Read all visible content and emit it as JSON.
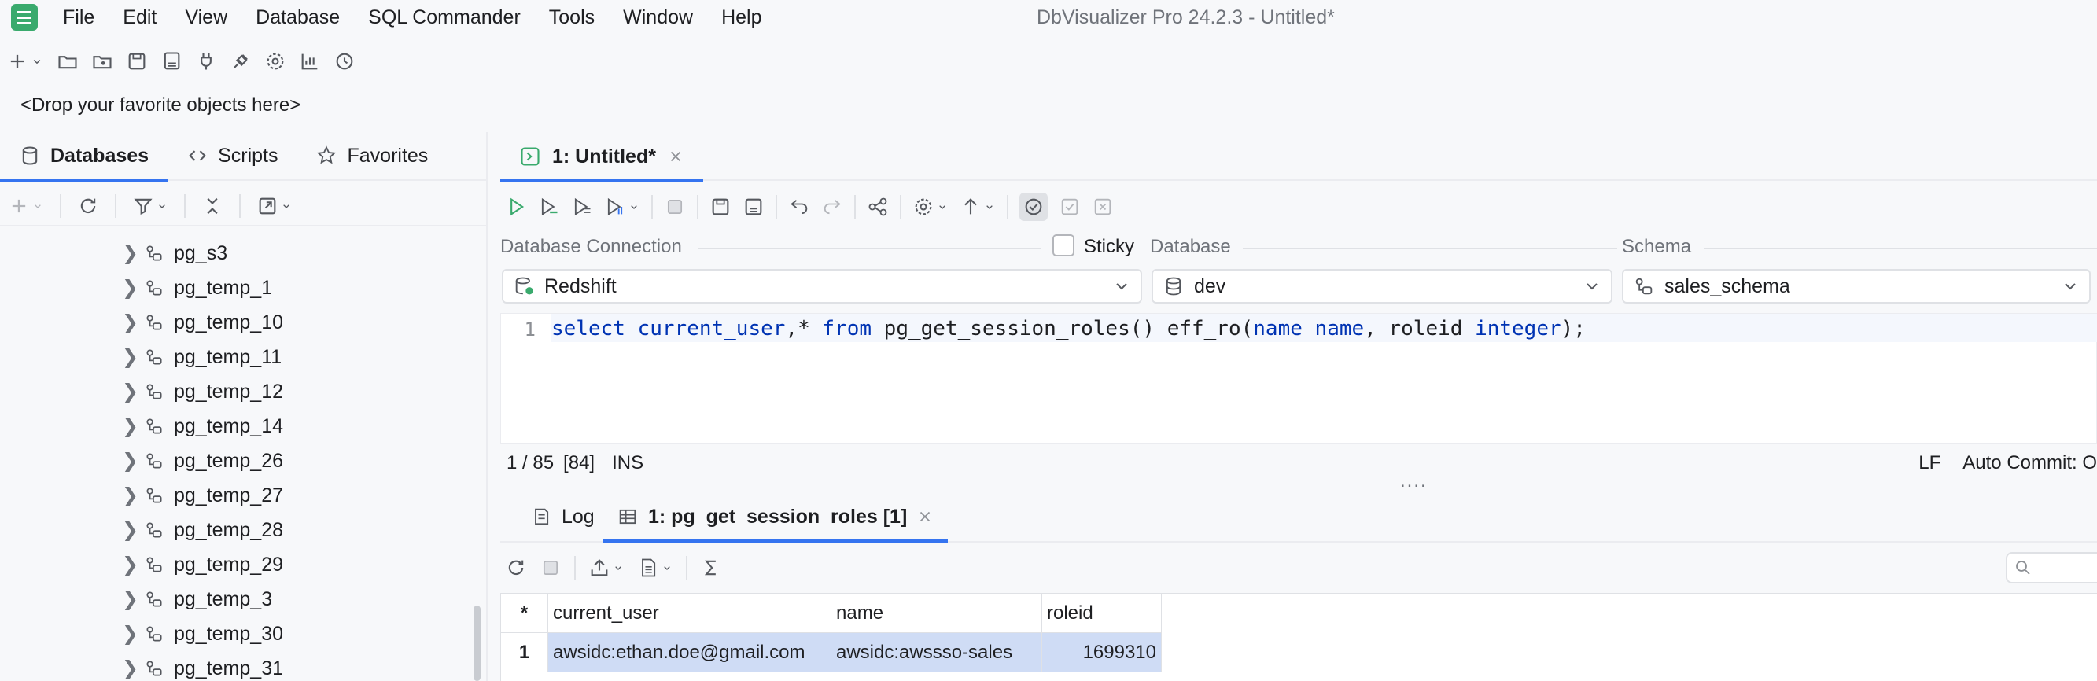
{
  "window": {
    "title": "DbVisualizer Pro 24.2.3 - Untitled*"
  },
  "menu": [
    "File",
    "Edit",
    "View",
    "Database",
    "SQL Commander",
    "Tools",
    "Window",
    "Help"
  ],
  "drop_zone": "<Drop your favorite objects here>",
  "left_tabs": [
    {
      "label": "Databases",
      "icon": "database-icon",
      "active": true
    },
    {
      "label": "Scripts",
      "icon": "scripts-icon",
      "active": false
    },
    {
      "label": "Favorites",
      "icon": "star-icon",
      "active": false
    }
  ],
  "tree": [
    "pg_s3",
    "pg_temp_1",
    "pg_temp_10",
    "pg_temp_11",
    "pg_temp_12",
    "pg_temp_14",
    "pg_temp_26",
    "pg_temp_27",
    "pg_temp_28",
    "pg_temp_29",
    "pg_temp_3",
    "pg_temp_30",
    "pg_temp_31"
  ],
  "editor_tab": {
    "label": "1: Untitled*"
  },
  "connection": {
    "connection_label": "Database Connection",
    "connection_value": "Redshift",
    "sticky_label": "Sticky",
    "database_label": "Database",
    "database_value": "dev",
    "schema_label": "Schema",
    "schema_value": "sales_schema"
  },
  "editor": {
    "line_number": "1",
    "code_parts": {
      "p1": "select",
      "p2": " ",
      "p3": "current_user",
      "p4": ",* ",
      "p5": "from",
      "p6": " pg_get_session_roles() eff_ro(",
      "p7": "name name",
      "p8": ", roleid ",
      "p9": "integer",
      "p10": ");"
    }
  },
  "status": {
    "position": "1 / 85",
    "offset": "[84]",
    "mode": "INS",
    "line_ending": "LF",
    "autocommit": "Auto Commit: O"
  },
  "result_tabs": [
    {
      "label": "Log",
      "icon": "log-icon",
      "active": false
    },
    {
      "label": "1: pg_get_session_roles [1]",
      "icon": "grid-icon",
      "active": true
    }
  ],
  "grid": {
    "corner": "*",
    "columns": [
      "current_user",
      "name",
      "roleid"
    ],
    "rows": [
      {
        "num": "1",
        "cells": [
          "awsidc:ethan.doe@gmail.com",
          "awsidc:awssso-sales",
          "1699310"
        ]
      }
    ]
  }
}
